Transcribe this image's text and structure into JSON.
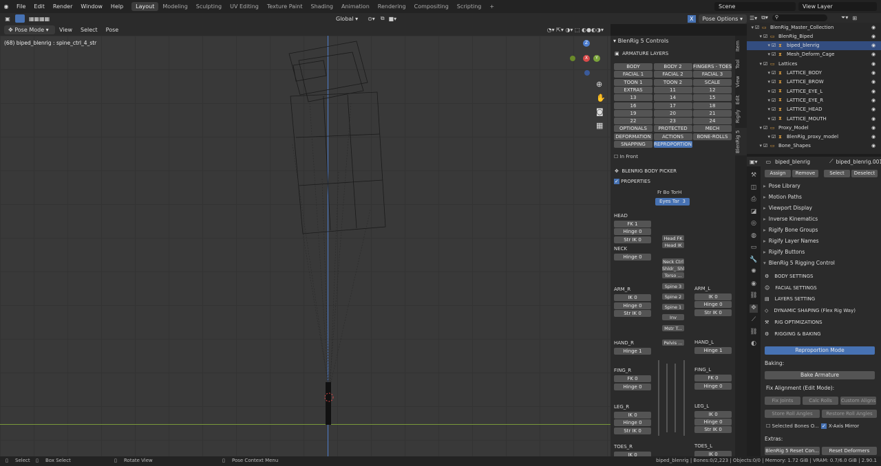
{
  "menus": [
    "File",
    "Edit",
    "Render",
    "Window",
    "Help"
  ],
  "workspaces": [
    "Layout",
    "Modeling",
    "Sculpting",
    "UV Editing",
    "Texture Paint",
    "Shading",
    "Animation",
    "Rendering",
    "Compositing",
    "Scripting",
    "+"
  ],
  "scene": "Scene",
  "view_layer": "View Layer",
  "viewport": {
    "mode": "Pose Mode",
    "view": "View",
    "select": "Select",
    "pose": "Pose",
    "orientation": "Global",
    "pose_options": "Pose Options",
    "x_label": "X",
    "info": "(68) biped_blenrig : spine_ctrl_4_str",
    "gizmo": {
      "z": "Z",
      "x": "X",
      "y": "Y"
    }
  },
  "npanel": {
    "title": "BlenRig 5 Controls",
    "layers_title": "ARMATURE LAYERS",
    "layers": [
      [
        "BODY",
        "BODY 2",
        "FINGERS - TOES"
      ],
      [
        "FACIAL 1",
        "FACIAL 2",
        "FACIAL 3"
      ],
      [
        "TOON 1",
        "TOON 2",
        "SCALE"
      ],
      [
        "EXTRAS",
        "11",
        "12"
      ],
      [
        "13",
        "14",
        "15"
      ],
      [
        "16",
        "17",
        "18"
      ],
      [
        "19",
        "20",
        "21"
      ],
      [
        "22",
        "23",
        "24"
      ],
      [
        "OPTIONALS",
        "PROTECTED",
        "MECH"
      ],
      [
        "DEFORMATION",
        "ACTIONS",
        "BONE-ROLLS"
      ],
      [
        "SNAPPING",
        "REPROPORTION",
        ""
      ]
    ],
    "in_front": "In Front",
    "picker_title": "BLENRIG BODY PICKER",
    "properties": "PROPERTIES",
    "picker_header": "Fr  Bo  TorH",
    "eyes": "Eyes Tar",
    "eyes_val": "3",
    "left": [
      {
        "section": "HEAD",
        "rows": [
          "FK 1",
          "Hinge 0",
          "Str IK 0"
        ]
      },
      {
        "section": "NECK",
        "rows": [
          "Hinge 0"
        ]
      },
      {
        "section": "ARM_R",
        "rows": [
          "IK 0",
          "Hinge 0",
          "Str IK 0"
        ]
      },
      {
        "section": "HAND_R",
        "rows": [
          "Hinge 1"
        ]
      },
      {
        "section": "FING_R",
        "rows": [
          "FK 0",
          "Hinge 0"
        ]
      },
      {
        "section": "LEG_R",
        "rows": [
          "IK 0",
          "Hinge 0",
          "Str IK 0"
        ]
      },
      {
        "section": "TOES_R",
        "rows": [
          "IK 0"
        ]
      }
    ],
    "right": [
      {
        "section": "ARM_L",
        "rows": [
          "IK 0",
          "Hinge 0",
          "Str IK 0"
        ]
      },
      {
        "section": "HAND_L",
        "rows": [
          "Hinge 1"
        ]
      },
      {
        "section": "FING_L",
        "rows": [
          "FK 0",
          "Hinge 0"
        ]
      },
      {
        "section": "LEG_L",
        "rows": [
          "IK 0",
          "Hinge 0",
          "Str IK 0"
        ]
      },
      {
        "section": "TOES_L",
        "rows": [
          "IK 0"
        ]
      }
    ],
    "center": [
      "Head FK",
      "Head IK",
      "Neck Ctrl",
      "Shldr_ Shld",
      "Torso ...",
      "Spine 3",
      "Spine 2",
      "Spine 1",
      "Inv",
      "Mstr T...",
      "Pelvis ..."
    ],
    "vtabs": [
      "Item",
      "Tool",
      "View",
      "Edit",
      "Rigify",
      "BlenRig 5"
    ]
  },
  "outliner": [
    {
      "name": "BlenRig_Master_Collection",
      "indent": 0
    },
    {
      "name": "BlenRig_Biped",
      "indent": 1
    },
    {
      "name": "biped_blenrig",
      "indent": 2,
      "selected": true
    },
    {
      "name": "Mesh_Deform_Cage",
      "indent": 2
    },
    {
      "name": "Lattices",
      "indent": 1
    },
    {
      "name": "LATTICE_BODY",
      "indent": 2
    },
    {
      "name": "LATTICE_BROW",
      "indent": 2
    },
    {
      "name": "LATTICE_EYE_L",
      "indent": 2
    },
    {
      "name": "LATTICE_EYE_R",
      "indent": 2
    },
    {
      "name": "LATTICE_HEAD",
      "indent": 2
    },
    {
      "name": "LATTICE_MOUTH",
      "indent": 2
    },
    {
      "name": "Proxy_Model",
      "indent": 1
    },
    {
      "name": "BlenRig_proxy_model",
      "indent": 2
    },
    {
      "name": "Bone_Shapes",
      "indent": 1
    }
  ],
  "properties": {
    "object": "biped_blenrig",
    "armature": "biped_blenrig.001",
    "buttons": [
      "Assign",
      "Remove",
      "Select",
      "Deselect"
    ],
    "panels": [
      "Pose Library",
      "Motion Paths",
      "Viewport Display",
      "Inverse Kinematics",
      "Rigify Bone Groups",
      "Rigify Layer Names",
      "Rigify Buttons",
      "BlenRig 5 Rigging Control"
    ],
    "items": [
      "BODY SETTINGS",
      "FACIAL SETTINGS",
      "LAYERS SETTING",
      "DYNAMIC SHAPING (Flex Rig Way)",
      "RIG OPTIMIZATIONS",
      "RIGGING & BAKING"
    ],
    "reproportion": "Reproportion Mode",
    "baking": "Baking:",
    "bake_armature": "Bake Armature",
    "fix_alignment": "Fix Alignment (Edit Mode):",
    "fix_buttons": [
      "Fix Joints",
      "Calc Rolls",
      "Custom Aligns"
    ],
    "roll_buttons": [
      "Store Roll Angles",
      "Restore Roll Angles"
    ],
    "selected_bones": "Selected Bones O...",
    "x_mirror": "X-Axis Mirror",
    "extras": "Extras:",
    "extras_buttons": [
      "BlenRig 5 Reset Con...",
      "Reset Deformers"
    ]
  },
  "status": {
    "select": "Select",
    "box_select": "Box Select",
    "rotate": "Rotate View",
    "context": "Pose Context Menu",
    "right": "biped_blenrig | Bones:0/2,223 | Objects:0/0 | Memory: 1.72 GiB | VRAM: 0.7/6.0 GiB | 2.90.1"
  }
}
